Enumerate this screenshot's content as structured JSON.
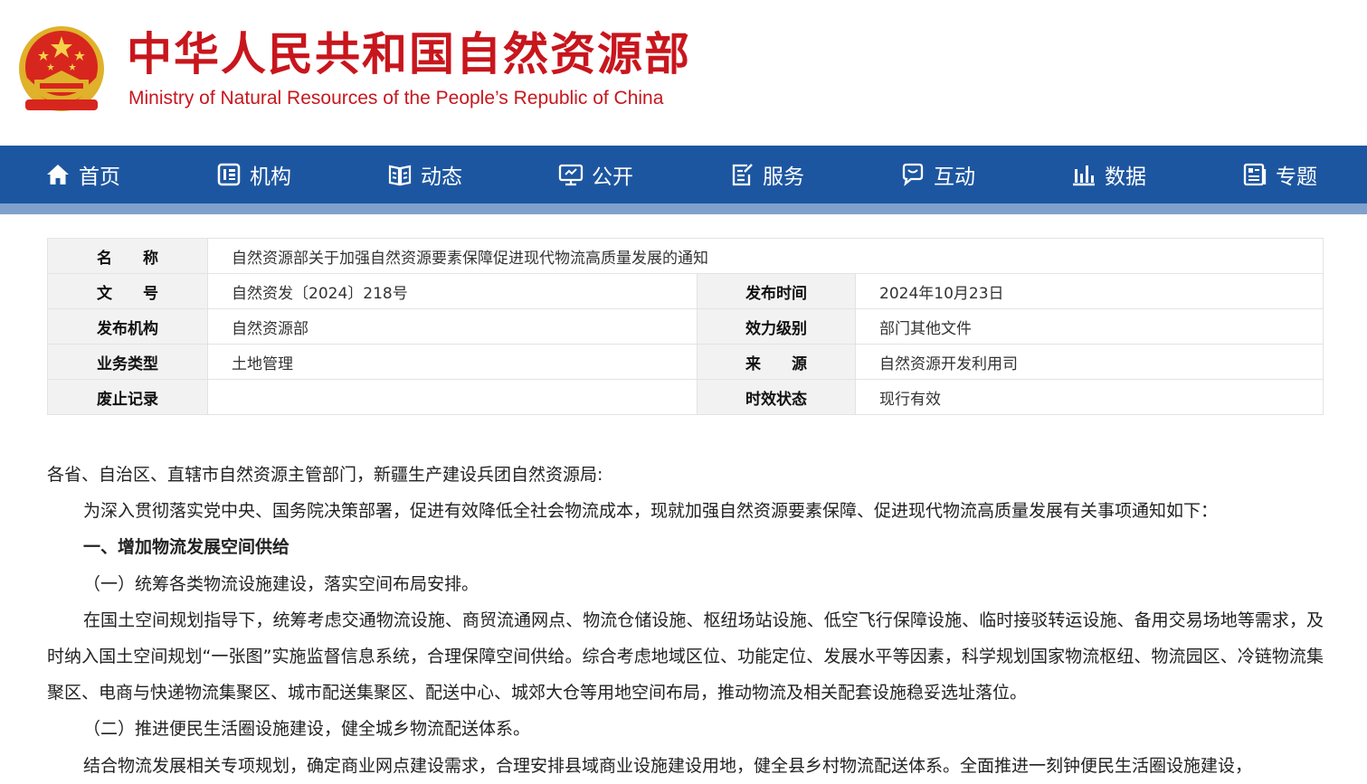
{
  "header": {
    "title_cn": "中华人民共和国自然资源部",
    "title_en": "Ministry of Natural Resources of the People’s Republic of China",
    "brand_color": "#c8161d"
  },
  "nav": {
    "color": "#1d56a0",
    "items": [
      {
        "label": "首页",
        "icon": "home-icon"
      },
      {
        "label": "机构",
        "icon": "organization-icon"
      },
      {
        "label": "动态",
        "icon": "news-icon"
      },
      {
        "label": "公开",
        "icon": "disclosure-icon"
      },
      {
        "label": "服务",
        "icon": "service-icon"
      },
      {
        "label": "互动",
        "icon": "interaction-icon"
      },
      {
        "label": "数据",
        "icon": "data-chart-icon"
      },
      {
        "label": "专题",
        "icon": "topic-icon"
      }
    ]
  },
  "meta": {
    "name_label": "名　　称",
    "name_value": "自然资源部关于加强自然资源要素保障促进现代物流高质量发展的通知",
    "doc_no_label": "文　　号",
    "doc_no_value": "自然资发〔2024〕218号",
    "date_label": "发布时间",
    "date_value": "2024年10月23日",
    "issuer_label": "发布机构",
    "issuer_value": "自然资源部",
    "level_label": "效力级别",
    "level_value": "部门其他文件",
    "type_label": "业务类型",
    "type_value": "土地管理",
    "source_label": "来　　源",
    "source_value": "自然资源开发利用司",
    "abolish_label": "废止记录",
    "abolish_value": "",
    "status_label": "时效状态",
    "status_value": "现行有效"
  },
  "body": {
    "salutation": "各省、自治区、直辖市自然资源主管部门，新疆生产建设兵团自然资源局:",
    "intro": "为深入贯彻落实党中央、国务院决策部署，促进有效降低全社会物流成本，现就加强自然资源要素保障、促进现代物流高质量发展有关事项通知如下：",
    "section1": "一、增加物流发展空间供给",
    "sub1": "（一）统筹各类物流设施建设，落实空间布局安排。",
    "para1": "在国土空间规划指导下，统筹考虑交通物流设施、商贸流通网点、物流仓储设施、枢纽场站设施、低空飞行保障设施、临时接驳转运设施、备用交易场地等需求，及时纳入国土空间规划“一张图”实施监督信息系统，合理保障空间供给。综合考虑地域区位、功能定位、发展水平等因素，科学规划国家物流枢纽、物流园区、冷链物流集聚区、电商与快递物流集聚区、城市配送集聚区、配送中心、城郊大仓等用地空间布局，推动物流及相关配套设施稳妥选址落位。",
    "sub2": "（二）推进便民生活圈设施建设，健全城乡物流配送体系。",
    "para2": "结合物流发展相关专项规划，确定商业网点建设需求，合理安排县域商业设施建设用地，健全县乡村物流配送体系。全面推进一刻钟便民生活圈设施建设，"
  }
}
